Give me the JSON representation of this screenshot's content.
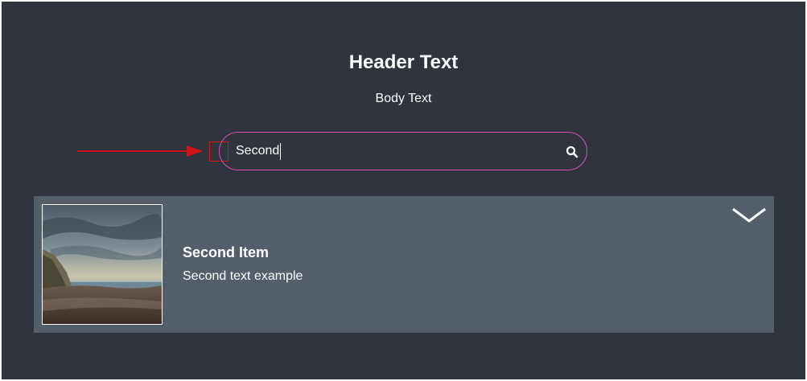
{
  "header": {
    "title": "Header Text",
    "body": "Body Text"
  },
  "search": {
    "value": "Second",
    "icon": "search-icon",
    "border_color": "#d94fb0"
  },
  "annotation": {
    "color": "#d0141c"
  },
  "item": {
    "title": "Second Item",
    "subtitle": "Second text example",
    "thumbnail": "coastal-beach-cliff-photo",
    "expand_icon": "chevron-down-icon"
  },
  "colors": {
    "background": "#30343c",
    "card": "#545e68",
    "text": "#ffffff"
  }
}
